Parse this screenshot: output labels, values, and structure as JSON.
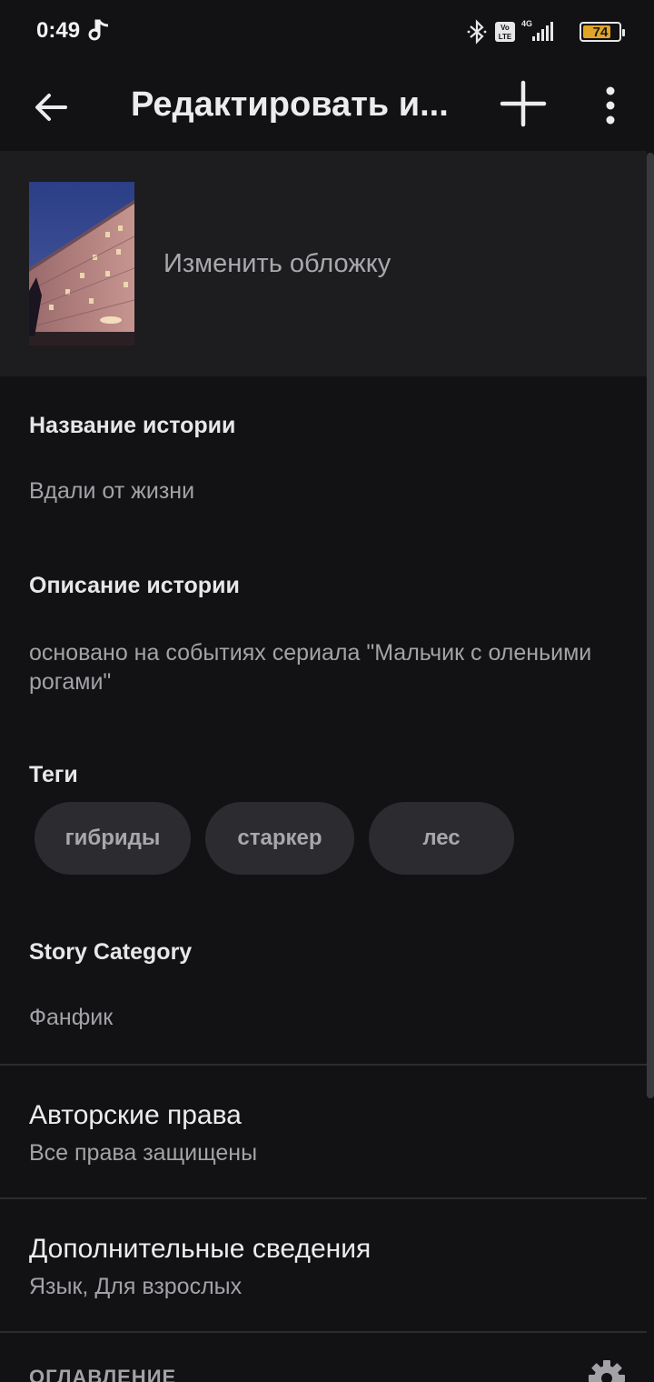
{
  "status_bar": {
    "time": "0:49",
    "battery": "74",
    "icons": [
      "music-note-icon",
      "bluetooth-icon",
      "volte-icon",
      "signal-4g-icon",
      "battery-icon"
    ]
  },
  "toolbar": {
    "title": "Редактировать и...",
    "back_icon": "back-arrow-icon",
    "add_icon": "plus-icon",
    "more_icon": "more-vert-icon"
  },
  "cover": {
    "label": "Изменить обложку"
  },
  "story": {
    "title_label": "Название истории",
    "title_value": "Вдали от жизни",
    "description_label": "Описание истории",
    "description_value": "основано на событиях сериала \"Мальчик с оленьими рогами\"",
    "tags_label": "Теги",
    "tags": [
      "гибриды",
      "старкер",
      "лес"
    ],
    "category_label": "Story Category",
    "category_value": "Фанфик"
  },
  "rows": {
    "copyright_title": "Авторские права",
    "copyright_sub": "Все права защищены",
    "details_title": "Дополнительные сведения",
    "details_sub": "Язык, Для взрослых"
  },
  "toc": {
    "header": "ОГЛАВЛЕНИЕ",
    "settings_icon": "gear-icon"
  },
  "colors": {
    "background": "#121114",
    "cover_section": "#1d1c1f",
    "tag_chip": "#2c2b2f",
    "battery": "#e0a526"
  }
}
